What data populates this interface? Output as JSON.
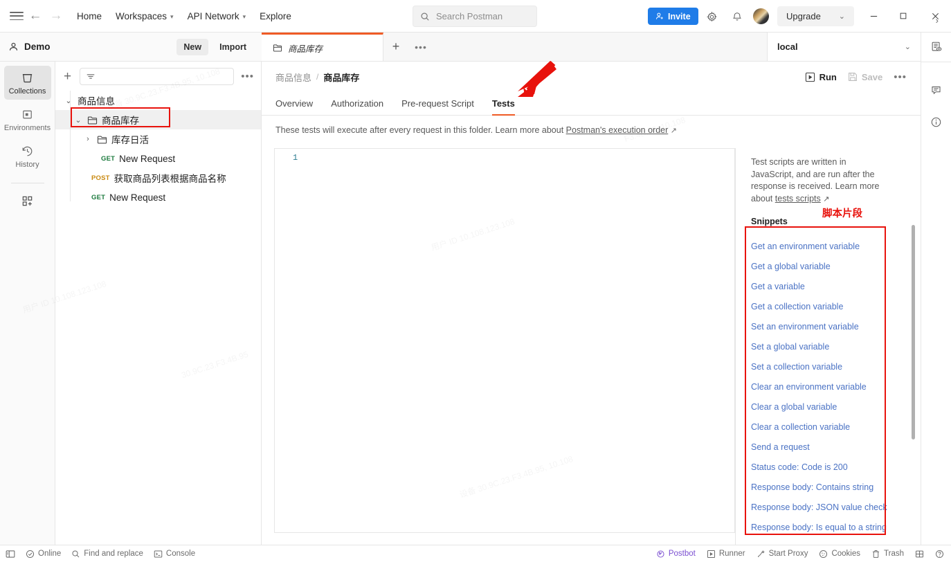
{
  "header": {
    "nav": [
      {
        "label": "Home",
        "caret": false
      },
      {
        "label": "Workspaces",
        "caret": true
      },
      {
        "label": "API Network",
        "caret": true
      },
      {
        "label": "Explore",
        "caret": false
      }
    ],
    "search": {
      "placeholder": "Search Postman",
      "value": "",
      "icon": "search-icon"
    },
    "invite_label": "Invite",
    "settings_icon": "gear-icon",
    "notifications_icon": "bell-icon",
    "avatar_icon": "user-avatar",
    "upgrade_label": "Upgrade",
    "window_controls": {
      "minimize": "—",
      "maximize": "□",
      "close": "✕"
    }
  },
  "workspace": {
    "name": "Demo",
    "new_label": "New",
    "import_label": "Import"
  },
  "rail": {
    "items": [
      {
        "label": "Collections",
        "icon": "collections-icon",
        "active": true
      },
      {
        "label": "Environments",
        "icon": "environments-icon",
        "active": false
      },
      {
        "label": "History",
        "icon": "history-icon",
        "active": false
      }
    ],
    "add_label": "",
    "add_icon": "add-module-icon"
  },
  "sidebar": {
    "filter_placeholder": "",
    "plus_icon": "plus-icon",
    "filter_icon": "filter-icon",
    "more_icon": "more-horizontal-icon",
    "tree": [
      {
        "label": "商品信息",
        "type": "collection",
        "depth": 0,
        "expanded": true,
        "method": "",
        "selected": false
      },
      {
        "label": "商品库存",
        "type": "folder",
        "depth": 1,
        "expanded": true,
        "method": "",
        "selected": true
      },
      {
        "label": "库存日活",
        "type": "folder",
        "depth": 2,
        "expanded": false,
        "method": "",
        "selected": false
      },
      {
        "label": "New Request",
        "type": "request",
        "depth": 3,
        "expanded": null,
        "method": "GET",
        "selected": false
      },
      {
        "label": "获取商品列表根据商品名称",
        "type": "request",
        "depth": 2,
        "expanded": null,
        "method": "POST",
        "selected": false
      },
      {
        "label": "New Request",
        "type": "request",
        "depth": 2,
        "expanded": null,
        "method": "GET",
        "selected": false
      }
    ]
  },
  "tabstrip": {
    "tabs": [
      {
        "label": "商品库存",
        "icon": "folder-icon",
        "active": true
      }
    ],
    "new_tab_icon": "plus-icon",
    "more_icon": "more-horizontal-icon"
  },
  "environment": {
    "selected": "local",
    "caret_icon": "chevron-down-icon",
    "env_quick_look_icon": "env-quick-look-icon"
  },
  "right_rail": {
    "items": [
      {
        "icon": "comment-icon",
        "label": ""
      },
      {
        "icon": "info-circle-icon",
        "label": ""
      }
    ]
  },
  "main": {
    "breadcrumb": {
      "parent": "商品信息",
      "separator": "/",
      "current": "商品库存"
    },
    "run_label": "Run",
    "save_label": "Save",
    "more_icon": "more-horizontal-icon",
    "tabs": [
      {
        "label": "Overview",
        "active": false
      },
      {
        "label": "Authorization",
        "active": false
      },
      {
        "label": "Pre-request Script",
        "active": false
      },
      {
        "label": "Tests",
        "active": true
      }
    ],
    "hint_text": "These tests will execute after every request in this folder. Learn more about ",
    "hint_link": "Postman's execution order",
    "hint_link_icon": "external-link-icon",
    "editor": {
      "line_numbers": [
        "1"
      ],
      "content": ""
    }
  },
  "snippets": {
    "description": "Test scripts are written in JavaScript, and are run after the response is received. Learn more about ",
    "description_link": "tests scripts",
    "description_link_icon": "external-link-icon",
    "collapse_icon": "chevron-right-icon",
    "title": "Snippets",
    "annotation_cn": "脚本片段",
    "items": [
      "Get an environment variable",
      "Get a global variable",
      "Get a variable",
      "Get a collection variable",
      "Set an environment variable",
      "Set a global variable",
      "Set a collection variable",
      "Clear an environment variable",
      "Clear a global variable",
      "Clear a collection variable",
      "Send a request",
      "Status code: Code is 200",
      "Response body: Contains string",
      "Response body: JSON value check",
      "Response body: Is equal to a string"
    ]
  },
  "statusbar": {
    "left": [
      {
        "label": "",
        "icon": "sidebar-toggle-icon"
      },
      {
        "label": "Online",
        "icon": "check-circle-icon"
      },
      {
        "label": "Find and replace",
        "icon": "search-icon"
      },
      {
        "label": "Console",
        "icon": "console-icon"
      }
    ],
    "right": [
      {
        "label": "Postbot",
        "icon": "postbot-icon"
      },
      {
        "label": "Runner",
        "icon": "runner-icon"
      },
      {
        "label": "Start Proxy",
        "icon": "proxy-icon"
      },
      {
        "label": "Cookies",
        "icon": "cookies-icon"
      },
      {
        "label": "Trash",
        "icon": "trash-icon"
      },
      {
        "label": "",
        "icon": "layout-icon"
      },
      {
        "label": "",
        "icon": "help-circle-icon"
      }
    ]
  },
  "colors": {
    "accent_orange": "#ef5b25",
    "annotation_red": "#e8120c",
    "link_blue": "#4a72c4",
    "invite_blue": "#1f7ce8",
    "get_green": "#1c7a3e",
    "post_orange": "#c98a12",
    "postbot_purple": "#7b4fd1"
  },
  "watermarks": [
    "设备 30.9C.23.F3.4B.95, 10.108",
    "用户 ID 10.108.123.108",
    "F3.4B.95, 10.108",
    "30.9C.23.F3.4B.95"
  ]
}
